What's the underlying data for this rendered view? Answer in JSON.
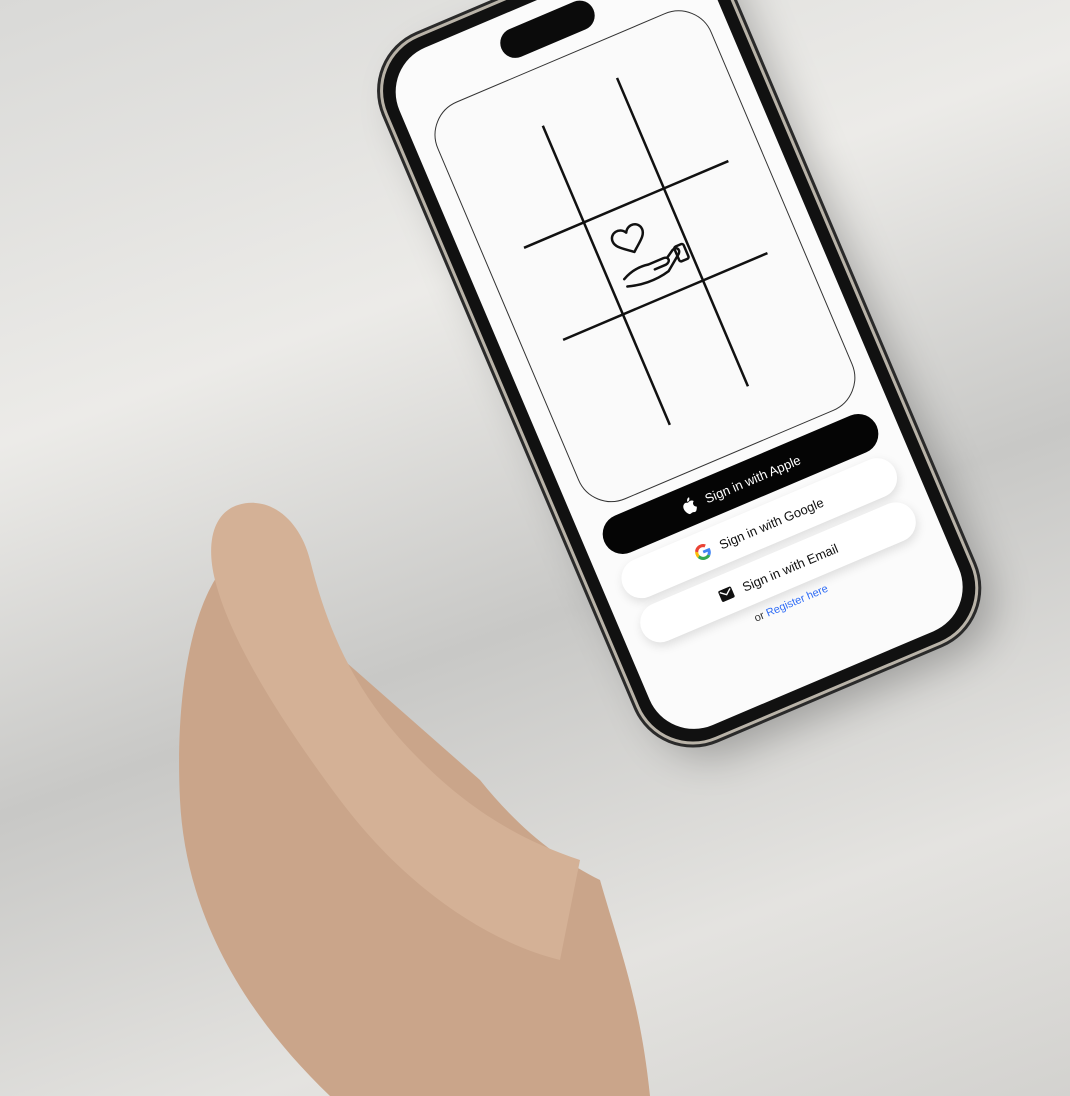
{
  "signin": {
    "apple_label": "Sign in with Apple",
    "google_label": "Sign in with Google",
    "email_label": "Sign in with Email",
    "register_prefix": "or",
    "register_link": "Register here"
  },
  "icons": {
    "apple": "apple-icon",
    "google": "google-icon",
    "email": "envelope-icon",
    "logo": "heart-in-hand-icon"
  },
  "colors": {
    "primary_button": "#050505",
    "link": "#2f6cf5",
    "screen_bg": "#fbfbfb"
  }
}
